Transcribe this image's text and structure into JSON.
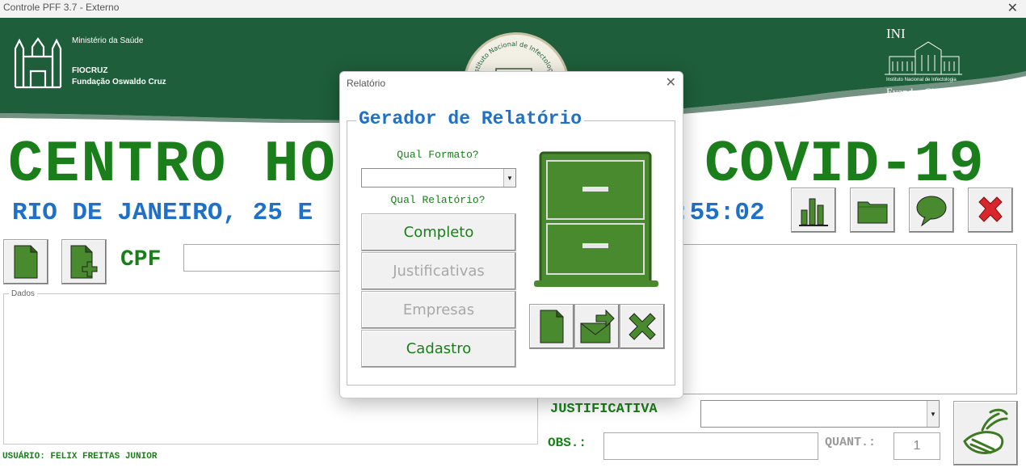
{
  "window": {
    "title": "Controle PFF 3.7 - Externo",
    "close_glyph": "✕"
  },
  "header": {
    "ministry": "Ministério da Saúde",
    "fiocruz": "FIOCRUZ",
    "fundacao": "Fundação Oswaldo Cruz",
    "ini_abbr": "INI",
    "ini_full": "Instituto Nacional de Infectologia",
    "ini_name": "Evandro Chagas",
    "seal_text": "Instituto Nacional de Infectologia Evandro Chagas"
  },
  "main": {
    "title_left": "CENTRO HO",
    "title_right": "COVID-19",
    "city_date": "RIO DE JANEIRO, 25 E",
    "clock": ":55:02",
    "cpf_label": "CPF",
    "dados_label": "Dados",
    "justificativa_label": "JUSTIFICATIVA",
    "obs_label": "OBS.:",
    "quant_label": "QUANT.:",
    "quant_value": "1",
    "user_label": "USUÁRIO: FELIX FREITAS JUNIOR"
  },
  "toolbar_icons": [
    "chart-icon",
    "folder-icon",
    "chat-bubble-icon",
    "close-x-icon"
  ],
  "left_icons": [
    "document-icon",
    "document-add-icon"
  ],
  "dialog": {
    "title": "Relatório",
    "close_glyph": "✕",
    "heading": "Gerador de Relatório",
    "format_label": "Qual Formato?",
    "format_value": "",
    "report_label": "Qual Relatório?",
    "buttons": [
      {
        "label": "Completo",
        "enabled": true
      },
      {
        "label": "Justificativas",
        "enabled": false
      },
      {
        "label": "Empresas",
        "enabled": false
      },
      {
        "label": "Cadastro",
        "enabled": true
      }
    ],
    "action_icons": [
      "document-icon",
      "mail-send-icon",
      "cancel-x-icon"
    ]
  },
  "colors": {
    "header_green": "#1e5e3a",
    "title_green": "#1a7f1a",
    "icon_green": "#4a8a2e",
    "blue_text": "#1f70c9",
    "disabled_text": "#a8a8a8",
    "red_x": "#d9262c"
  }
}
